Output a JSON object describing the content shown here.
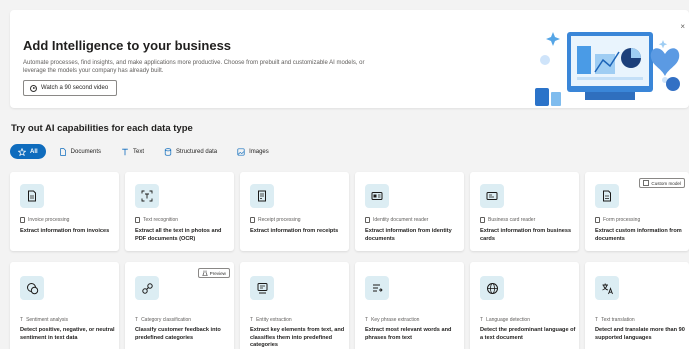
{
  "banner": {
    "title": "Add Intelligence to your business",
    "description": "Automate processes, find insights, and make applications more productive. Choose from prebuilt and customizable AI models, or leverage the models your company has already built.",
    "watch_label": "Watch a 90 second video"
  },
  "section": {
    "title": "Try out AI capabilities for each data type"
  },
  "filters": [
    {
      "label": "All",
      "icon": "star-icon"
    },
    {
      "label": "Documents",
      "icon": "document-icon"
    },
    {
      "label": "Text",
      "icon": "text-icon"
    },
    {
      "label": "Structured data",
      "icon": "database-icon"
    },
    {
      "label": "Images",
      "icon": "image-icon"
    }
  ],
  "cards": [
    {
      "category": "Invoice processing",
      "title": "Extract information from invoices",
      "icon": "invoice-icon"
    },
    {
      "category": "Text recognition",
      "title": "Extract all the text in photos and PDF documents (OCR)",
      "icon": "text-recognition-icon"
    },
    {
      "category": "Receipt processing",
      "title": "Extract information from receipts",
      "icon": "receipt-icon"
    },
    {
      "category": "Identity document reader",
      "title": "Extract information from identity documents",
      "icon": "id-card-icon"
    },
    {
      "category": "Business card reader",
      "title": "Extract information from business cards",
      "icon": "business-card-icon"
    },
    {
      "category": "Form processing",
      "title": "Extract custom information from documents",
      "icon": "form-icon",
      "tag": "Custom model"
    },
    {
      "category": "Sentiment analysis",
      "title": "Detect positive, negative, or neutral sentiment in text data",
      "icon": "sentiment-icon"
    },
    {
      "category": "Category classification",
      "title": "Classify customer feedback into predefined categories",
      "icon": "classification-icon",
      "tag": "Preview"
    },
    {
      "category": "Entity extraction",
      "title": "Extract key elements from text, and classifies them into predefined categories",
      "icon": "entity-icon"
    },
    {
      "category": "Key phrase extraction",
      "title": "Extract most relevant words and phrases from text",
      "icon": "key-phrase-icon"
    },
    {
      "category": "Language detection",
      "title": "Detect the predominant language of a text document",
      "icon": "globe-icon"
    },
    {
      "category": "Text translation",
      "title": "Detect and translate more than 90 supported languages",
      "icon": "translate-icon"
    }
  ],
  "colors": {
    "accent": "#0f6cbd",
    "icon_bg": "#dcedf3",
    "page_bg": "#f3f3f3"
  }
}
